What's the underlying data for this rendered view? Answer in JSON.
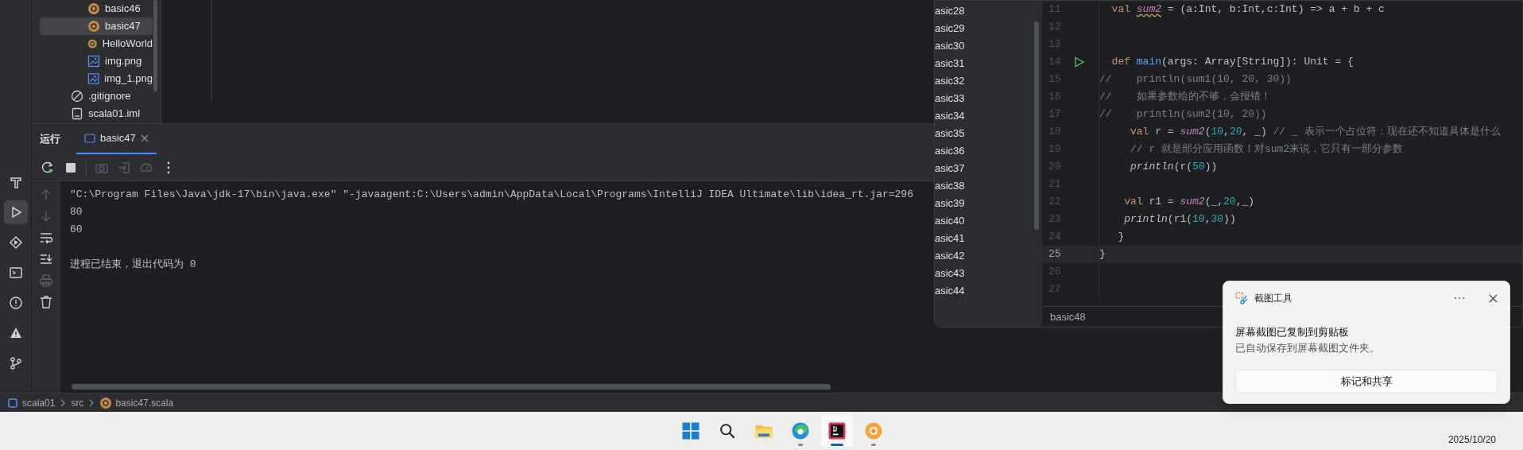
{
  "tool_strip": [
    {
      "kind": "build",
      "selected": false
    },
    {
      "kind": "run",
      "selected": true
    },
    {
      "kind": "services",
      "selected": false
    },
    {
      "kind": "terminal",
      "selected": false
    },
    {
      "kind": "problems",
      "selected": false
    },
    {
      "kind": "warning",
      "selected": false
    },
    {
      "kind": "git",
      "selected": false
    }
  ],
  "project_tree": {
    "nested_items": [
      {
        "label": "basic46",
        "kind": "scala",
        "selected": false
      },
      {
        "label": "basic47",
        "kind": "scala",
        "selected": true
      },
      {
        "label": "HelloWorld",
        "kind": "scala",
        "selected": false
      },
      {
        "label": "img.png",
        "kind": "image",
        "selected": false
      },
      {
        "label": "img_1.png",
        "kind": "image",
        "selected": false
      }
    ],
    "items": [
      {
        "label": ".gitignore",
        "kind": "ignore",
        "selected": false
      },
      {
        "label": "scala01.iml",
        "kind": "iml",
        "selected": false
      }
    ]
  },
  "run_window": {
    "title": "运行",
    "tabs": [
      {
        "label": "basic47",
        "selected": true
      }
    ],
    "toolbar": [
      {
        "kind": "rerun",
        "disabled": false
      },
      {
        "kind": "stop",
        "disabled": false
      },
      {
        "kind": "camera",
        "disabled": true
      },
      {
        "kind": "exit",
        "disabled": true
      },
      {
        "kind": "gauge",
        "disabled": true
      },
      {
        "kind": "more",
        "disabled": false
      }
    ],
    "gutter": [
      {
        "kind": "up",
        "disabled": true
      },
      {
        "kind": "down",
        "disabled": true
      },
      {
        "kind": "wrap",
        "disabled": false
      },
      {
        "kind": "scroll-end",
        "disabled": false
      },
      {
        "kind": "print",
        "disabled": true
      },
      {
        "kind": "trash",
        "disabled": false
      }
    ],
    "console": [
      {
        "kind": "command",
        "text": "\"C:\\Program Files\\Java\\jdk-17\\bin\\java.exe\" \"-javaagent:C:\\Users\\admin\\AppData\\Local\\Programs\\IntelliJ IDEA Ultimate\\lib\\idea_rt.jar=296"
      },
      {
        "kind": "output",
        "text": "80"
      },
      {
        "kind": "output",
        "text": "60"
      },
      {
        "kind": "exit",
        "text": "进程已结束，退出代码为 0"
      }
    ]
  },
  "breadcrumbs": [
    {
      "label": "scala01",
      "kind": "module"
    },
    {
      "label": "src",
      "kind": "folder"
    },
    {
      "label": "basic47.scala",
      "kind": "scala"
    }
  ],
  "second_window": {
    "tree": [
      "asic28",
      "asic29",
      "asic30",
      "asic31",
      "asic32",
      "asic33",
      "asic34",
      "asic35",
      "asic36",
      "asic37",
      "asic38",
      "asic39",
      "asic40",
      "asic41",
      "asic42",
      "asic43",
      "asic44"
    ],
    "code": [
      {
        "number": "11",
        "current": false,
        "runnable": false,
        "tokens": [
          {
            "text": "  val ",
            "kind": "kw"
          },
          {
            "text": "sum2",
            "kind": "warn"
          },
          {
            "text": " = (a:Int, b:Int,c:Int) => a + b + c",
            "kind": "plain"
          }
        ]
      },
      {
        "number": "12",
        "current": false,
        "runnable": false
      },
      {
        "number": "13",
        "current": false,
        "runnable": false
      },
      {
        "number": "14",
        "current": false,
        "runnable": true,
        "tokens": [
          {
            "text": "  def ",
            "kind": "kw"
          },
          {
            "text": "main",
            "kind": "method"
          },
          {
            "text": "(args: Array[String]): Unit = {",
            "kind": "plain"
          }
        ]
      },
      {
        "number": "15",
        "current": false,
        "runnable": false,
        "tokens": [
          {
            "text": "//    println(sum1(10, 20, 30))",
            "kind": "comment"
          }
        ]
      },
      {
        "number": "16",
        "current": false,
        "runnable": false,
        "tokens": [
          {
            "text": "//    如果参数给的不够，会报错！",
            "kind": "comment"
          }
        ]
      },
      {
        "number": "17",
        "current": false,
        "runnable": false,
        "tokens": [
          {
            "text": "//    println(sum2(10, 20))",
            "kind": "comment"
          }
        ]
      },
      {
        "number": "18",
        "current": false,
        "runnable": false,
        "tokens": [
          {
            "text": "     val ",
            "kind": "kw"
          },
          {
            "text": "r = ",
            "kind": "plain"
          },
          {
            "text": "sum2",
            "kind": "fn"
          },
          {
            "text": "(",
            "kind": "plain"
          },
          {
            "text": "10",
            "kind": "num"
          },
          {
            "text": ",",
            "kind": "plain"
          },
          {
            "text": "20",
            "kind": "num"
          },
          {
            "text": ", _) ",
            "kind": "plain"
          },
          {
            "text": "// _ 表示一个占位符：现在还不知道具体是什么",
            "kind": "comment"
          }
        ]
      },
      {
        "number": "19",
        "current": false,
        "runnable": false,
        "tokens": [
          {
            "text": "     // r 就是部分应用函数！对sum2来说，它只有一部分参数",
            "kind": "comment"
          }
        ]
      },
      {
        "number": "20",
        "current": false,
        "runnable": false,
        "tokens": [
          {
            "text": "     println",
            "kind": "call"
          },
          {
            "text": "(r(",
            "kind": "plain"
          },
          {
            "text": "50",
            "kind": "num"
          },
          {
            "text": "))",
            "kind": "plain"
          }
        ]
      },
      {
        "number": "21",
        "current": false,
        "runnable": false
      },
      {
        "number": "22",
        "current": false,
        "runnable": false,
        "tokens": [
          {
            "text": "    val ",
            "kind": "kw"
          },
          {
            "text": "r1 = ",
            "kind": "plain"
          },
          {
            "text": "sum2",
            "kind": "fn"
          },
          {
            "text": "(_,",
            "kind": "plain"
          },
          {
            "text": "20",
            "kind": "num"
          },
          {
            "text": ",_)",
            "kind": "plain"
          }
        ]
      },
      {
        "number": "23",
        "current": false,
        "runnable": false,
        "tokens": [
          {
            "text": "    println",
            "kind": "call"
          },
          {
            "text": "(r1(",
            "kind": "plain"
          },
          {
            "text": "10",
            "kind": "num"
          },
          {
            "text": ",",
            "kind": "plain"
          },
          {
            "text": "30",
            "kind": "num"
          },
          {
            "text": "))",
            "kind": "plain"
          }
        ]
      },
      {
        "number": "24",
        "current": false,
        "runnable": false,
        "tokens": [
          {
            "text": "   }",
            "kind": "plain"
          }
        ]
      },
      {
        "number": "25",
        "current": true,
        "runnable": false,
        "tokens": [
          {
            "text": "}",
            "kind": "plain"
          }
        ]
      },
      {
        "number": "26",
        "current": false,
        "runnable": false
      },
      {
        "number": "27",
        "current": false,
        "runnable": false
      }
    ],
    "status": "basic48"
  },
  "notification": {
    "app": "截图工具",
    "title": "屏幕截图已复制到剪贴板",
    "body": "已自动保存到屏幕截图文件夹。",
    "button": "标记和共享"
  },
  "taskbar": {
    "apps": [
      {
        "kind": "start",
        "running": false,
        "active": false
      },
      {
        "kind": "search",
        "running": false,
        "active": false
      },
      {
        "kind": "explorer",
        "running": false,
        "active": false
      },
      {
        "kind": "edge",
        "running": true,
        "active": false
      },
      {
        "kind": "intellij",
        "running": true,
        "active": true
      },
      {
        "kind": "orange",
        "running": true,
        "active": false
      }
    ],
    "date": "2025/10/20"
  }
}
